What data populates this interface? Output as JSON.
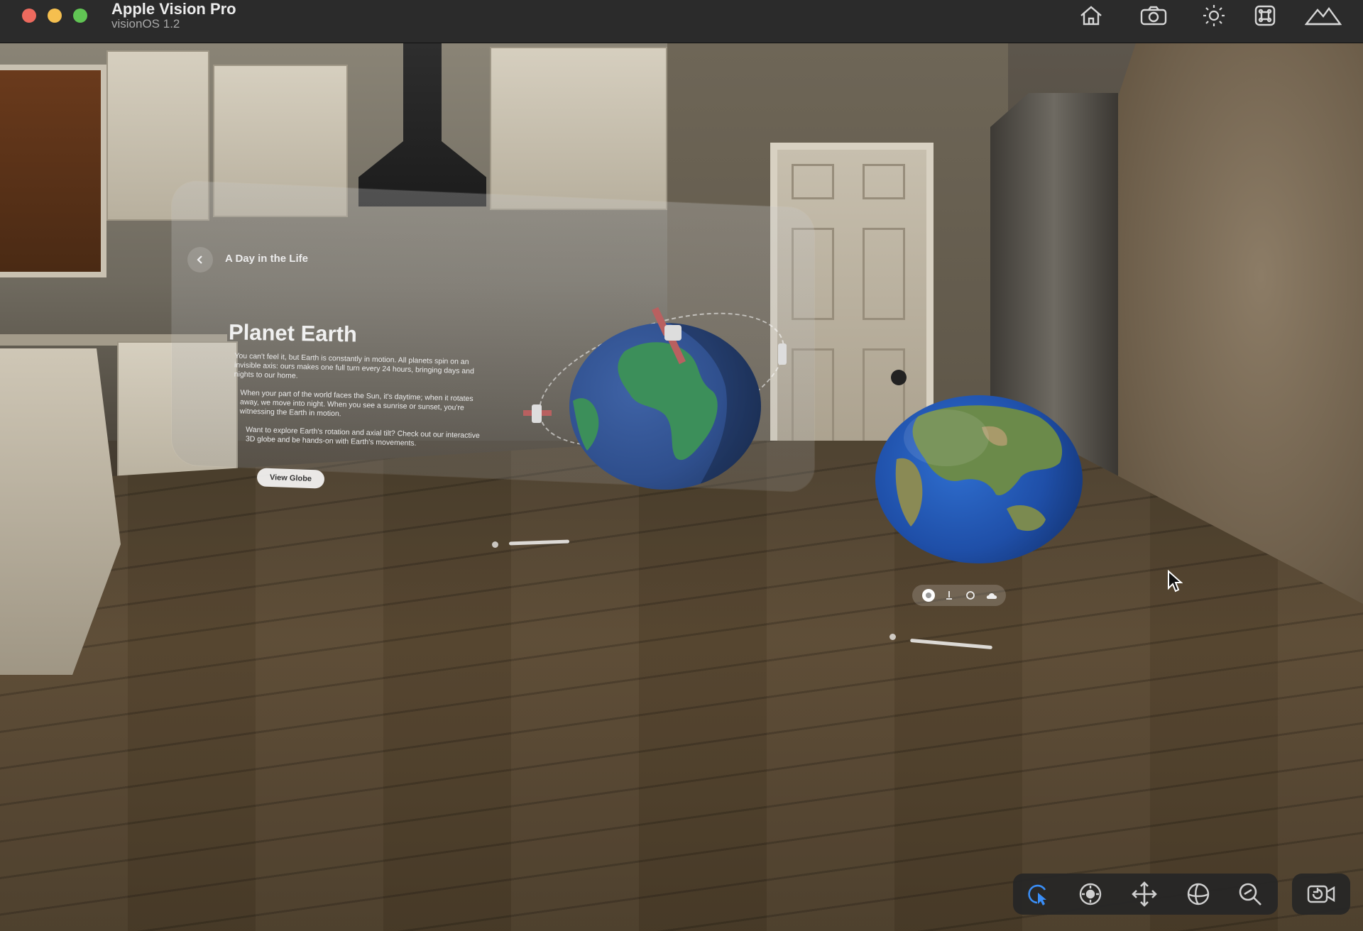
{
  "window": {
    "title": "Apple Vision Pro",
    "subtitle": "visionOS 1.2"
  },
  "toolbar_top": {
    "icons": [
      "home-icon",
      "camera-icon",
      "brightness-icon",
      "command-icon",
      "environment-icon"
    ]
  },
  "app_window": {
    "nav_title": "A Day in the Life",
    "heading": "Planet Earth",
    "paragraphs": [
      "You can't feel it, but Earth is constantly in motion. All planets spin on an invisible axis: ours makes one full turn every 24 hours, bringing days and nights to our home.",
      "When your part of the world faces the Sun, it's daytime; when it rotates away, we move into night. When you see a sunrise or sunset, you're witnessing the Earth in motion.",
      "Want to explore Earth's rotation and axial tilt? Check out our interactive 3D globe and be hands-on with Earth's movements."
    ],
    "button_label": "View Globe"
  },
  "toolbar_bottom": {
    "icons": [
      "select-pointer-icon",
      "look-around-icon",
      "pan-icon",
      "orbit-icon",
      "zoom-icon",
      "record-icon"
    ]
  },
  "colors": {
    "titlebar": "#2b2b2b",
    "close": "#ed6a5e",
    "minimize": "#f5bf4f",
    "maximize": "#61c554",
    "active_tool": "#3a8ef6"
  }
}
